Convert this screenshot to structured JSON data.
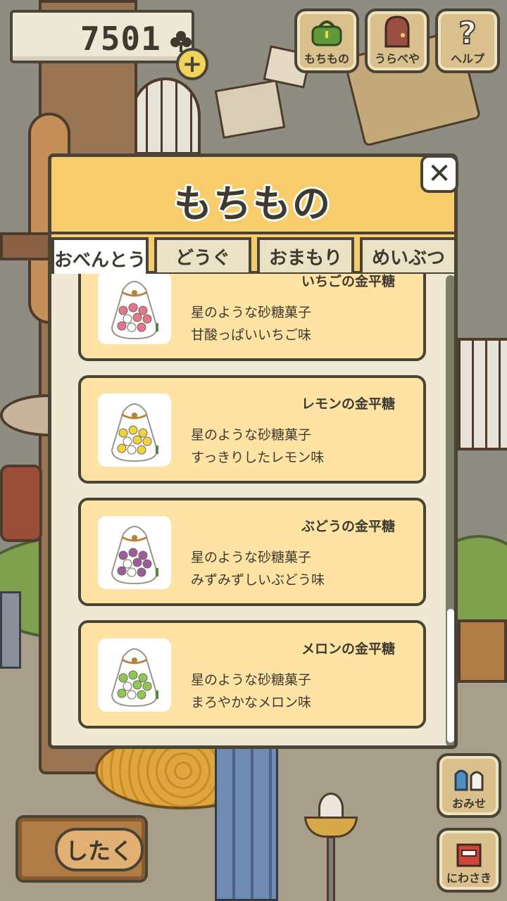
{
  "currency": {
    "value": "7501"
  },
  "top_buttons": [
    {
      "label": "もちもの",
      "icon": "bag-icon"
    },
    {
      "label": "うらべや",
      "icon": "door-icon"
    },
    {
      "label": "ヘルプ",
      "icon": "question-icon"
    }
  ],
  "modal": {
    "title": "もちもの",
    "close_label": "✕",
    "tabs": [
      {
        "label": "おべんとう",
        "active": true
      },
      {
        "label": "どうぐ",
        "active": false
      },
      {
        "label": "おまもり",
        "active": false
      },
      {
        "label": "めいぶつ",
        "active": false
      }
    ],
    "items": [
      {
        "name": "いちごの金平糖",
        "desc1": "星のような砂糖菓子",
        "desc2": "甘酸っぱいいちご味",
        "candy_color": "#e8748c"
      },
      {
        "name": "レモンの金平糖",
        "desc1": "星のような砂糖菓子",
        "desc2": "すっきりしたレモン味",
        "candy_color": "#f1d33c"
      },
      {
        "name": "ぶどうの金平糖",
        "desc1": "星のような砂糖菓子",
        "desc2": "みずみずしいぶどう味",
        "candy_color": "#9b5c9c"
      },
      {
        "name": "メロンの金平糖",
        "desc1": "星のような砂糖菓子",
        "desc2": "まろやかなメロン味",
        "candy_color": "#8fc94f"
      }
    ]
  },
  "bottom": {
    "prepare_label": "したく",
    "side_buttons": [
      {
        "label": "おみせ",
        "icon": "shop-icon"
      },
      {
        "label": "にわさき",
        "icon": "garden-icon"
      }
    ]
  },
  "colors": {
    "panel_header": "#f6cd6a",
    "item_bg": "#fee3a4",
    "outline": "#4a4436"
  }
}
